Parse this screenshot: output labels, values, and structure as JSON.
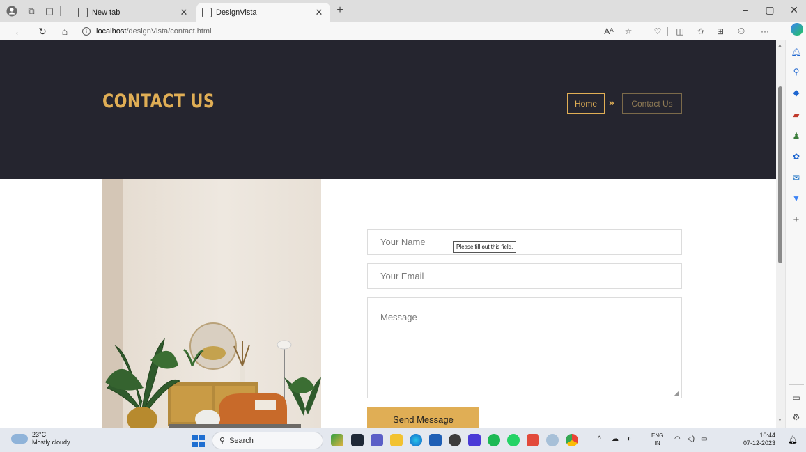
{
  "browser": {
    "tabs": [
      {
        "label": "New tab",
        "active": false
      },
      {
        "label": "DesignVista",
        "active": true
      }
    ],
    "url_host": "localhost",
    "url_path": "/designVista/contact.html"
  },
  "hero": {
    "title": "CONTACT US",
    "breadcrumb": {
      "home": "Home",
      "separator": "»",
      "current": "Contact Us"
    }
  },
  "form": {
    "name_placeholder": "Your Name",
    "email_placeholder": "Your Email",
    "message_placeholder": "Message",
    "tooltip": "Please fill out this field.",
    "submit_label": "Send Message"
  },
  "taskbar": {
    "temperature": "23°C",
    "weather": "Mostly cloudy",
    "search": "Search",
    "lang_top": "ENG",
    "lang_bottom": "IN",
    "time": "10:44",
    "date": "07-12-2023"
  },
  "colors": {
    "accent": "#e0ae55",
    "hero_bg": "#25252f"
  }
}
